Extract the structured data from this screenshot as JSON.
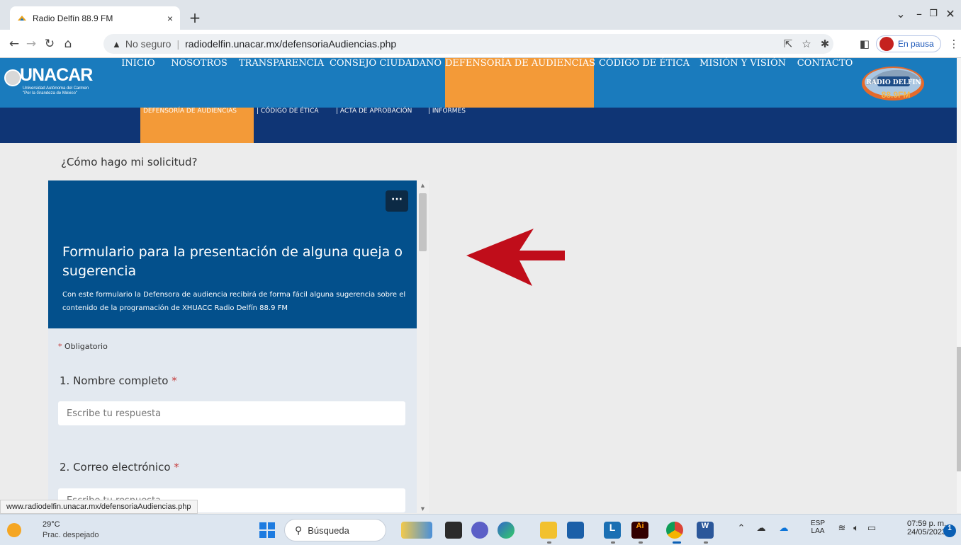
{
  "browser": {
    "tab_title": "Radio Delfín 88.9 FM",
    "tab_close": "×",
    "new_tab": "+",
    "security_label": "No seguro",
    "url": "radiodelfin.unacar.mx/defensoriaAudiencias.php",
    "profile_status": "En pausa",
    "status_url": "www.radiodelfin.unacar.mx/defensoriaAudiencias.php"
  },
  "site": {
    "logo_text": "UNACAR",
    "logo_subtitle": "Universidad Autónoma del Carmen \"Por la Grandeza de México\"",
    "nav": [
      {
        "label": "INICIO"
      },
      {
        "label": "NOSOTROS"
      },
      {
        "label": "TRANSPARENCIA"
      },
      {
        "label": "CONSEJO CIUDADANO"
      },
      {
        "label": "DEFENSORÍA DE AUDIENCIAS",
        "active": true
      },
      {
        "label": "CÓDIGO DE ÉTICA"
      },
      {
        "label": "MISIÓN Y VISIÓN"
      },
      {
        "label": "CONTACTO"
      }
    ],
    "subnav": [
      {
        "label": "DEFENSORÍA DE AUDIENCIAS",
        "active": true
      },
      {
        "label": "| CÓDIGO DE ÉTICA"
      },
      {
        "label": "| ACTA DE APROBACIÓN"
      },
      {
        "label": "| INFORMES"
      }
    ],
    "radio_logo_text": "RADIO DELFIN",
    "radio_logo_freq": "88.9FM"
  },
  "content": {
    "question": "¿Cómo hago mi solicitud?",
    "form": {
      "more_button": "···",
      "title": "Formulario para la presentación de alguna queja o sugerencia",
      "description": "Con este formulario la Defensora de audiencia recibirá de forma fácil alguna sugerencia sobre el contenido de la programación de XHUACC Radio Delfín 88.9 FM",
      "required_star": "*",
      "required_note": "Obligatorio",
      "questions": [
        {
          "label": "1. Nombre completo",
          "placeholder": "Escribe tu respuesta"
        },
        {
          "label": "2. Correo electrónico",
          "placeholder": "Escribe tu respuesta"
        }
      ]
    }
  },
  "taskbar": {
    "weather_temp": "29°C",
    "weather_condition": "Prac. despejado",
    "search_label": "Búsqueda",
    "lang_top": "ESP",
    "lang_bottom": "LAA",
    "time": "07:59 p. m.",
    "date": "24/05/2023",
    "notification_count": "1"
  },
  "colors": {
    "header_blue": "#1a7bbd",
    "subnav_navy": "#0f3575",
    "accent_orange": "#f39a38",
    "form_header": "#03508c",
    "arrow_red": "#c00d1a"
  }
}
